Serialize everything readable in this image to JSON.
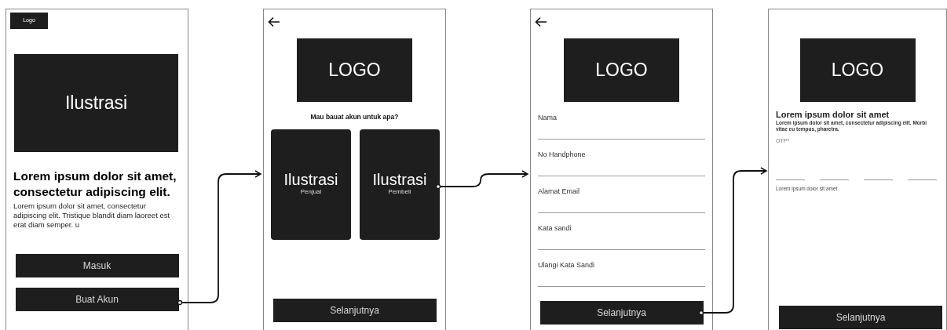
{
  "screens": [
    {
      "kind": "welcome",
      "logo": "Logo",
      "illustration": "Ilustrasi",
      "headline": "Lorem ipsum dolor sit amet, consectetur adipiscing elit.",
      "body": "Lorem ipsum dolor sit amet, consectetur adipiscing elit. Tristique blandit diam laoreet est erat diam semper. u",
      "buttons": [
        "Masuk",
        "Buat Akun"
      ]
    },
    {
      "kind": "role",
      "logo": "LOGO",
      "question": "Mau bauat akun untuk apa?",
      "options": [
        {
          "title": "Ilustrasi",
          "label": "Penjual"
        },
        {
          "title": "Ilustrasi",
          "label": "Pembeli"
        }
      ],
      "button": "Selanjutnya"
    },
    {
      "kind": "register",
      "logo": "LOGO",
      "fields": [
        {
          "label": "Nama"
        },
        {
          "label": "No Handphone"
        },
        {
          "label": "Alamat Email"
        },
        {
          "label": "Kata sandi"
        },
        {
          "label": "Ulangi Kata Sandi"
        }
      ],
      "button": "Selanjutnya"
    },
    {
      "kind": "otp",
      "logo": "LOGO",
      "title": "Lorem ipsum dolor sit amet",
      "body": "Lorem ipsum dolor sit amet, consectetur adipiscing elit. Morbi vitae eu tempus, pharetra.",
      "otp_label": "OTP*",
      "hint": "Lorem ipsum dolor sit amet",
      "button": "Selanjutnya"
    }
  ]
}
